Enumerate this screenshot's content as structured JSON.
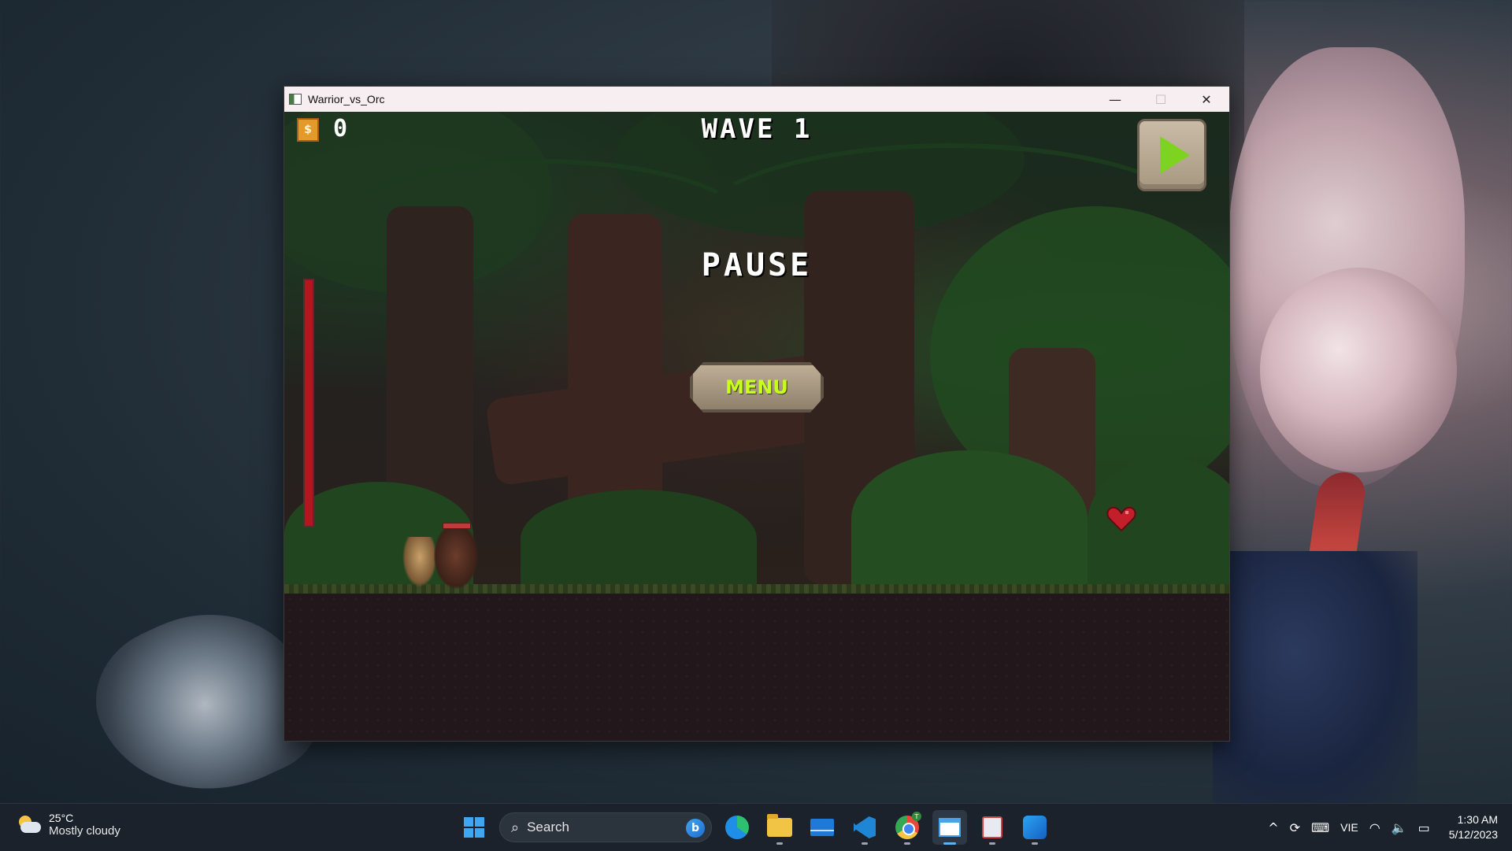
{
  "window": {
    "title": "Warrior_vs_Orc",
    "controls": {
      "minimize": "—",
      "maximize": "☐",
      "close": "✕"
    }
  },
  "game": {
    "coin_count": "0",
    "wave_label": "WAVE 1",
    "pause_title": "PAUSE",
    "menu_label": "MENU",
    "resume_icon": "play-icon",
    "player_health": 1.0,
    "colors": {
      "accent_green": "#7ed321",
      "menu_text": "#c8ff1a",
      "health": "#b3161f"
    }
  },
  "taskbar": {
    "weather": {
      "temp": "25°C",
      "desc": "Mostly cloudy"
    },
    "search_label": "Search",
    "bing_badge": "b",
    "pinned": [
      "start",
      "search",
      "edge",
      "file-explorer",
      "mail",
      "vscode",
      "chrome",
      "warrior-vs-orc",
      "snipping-tool",
      "paint"
    ],
    "chrome_badge": "T",
    "tray": {
      "chevron": "^",
      "language": "VIE",
      "time": "1:30 AM",
      "date": "5/12/2023"
    }
  }
}
